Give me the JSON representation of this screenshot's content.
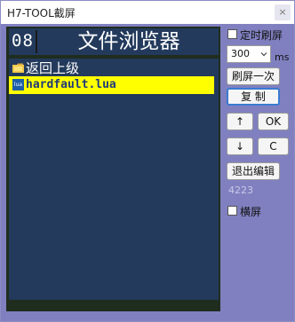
{
  "window": {
    "title": "H7-TOOL截屏",
    "close_glyph": "×"
  },
  "screen": {
    "page_number": "08",
    "title": "文件浏览器",
    "items": [
      {
        "icon": "folder-icon",
        "label": "返回上级",
        "selected": false
      },
      {
        "icon": "lua-file-icon",
        "icon_text": "lua",
        "label": "hardfault.lua",
        "selected": true
      }
    ],
    "colors": {
      "background": "#233a5c",
      "selection": "#ffff00",
      "selected_text": "#1f3a7a",
      "text": "#ffffff"
    }
  },
  "controls": {
    "timer_refresh": {
      "label": "定时刷屏",
      "checked": false
    },
    "interval": {
      "value": "300",
      "unit": "ms"
    },
    "refresh_once": "刷屏一次",
    "copy": "复 制",
    "up": "↑",
    "ok": "OK",
    "down": "↓",
    "c": "C",
    "exit_edit": "退出编辑",
    "status_value": "4223",
    "landscape": {
      "label": "横屏",
      "checked": false
    }
  },
  "colors": {
    "panel": "#8080c0",
    "lcd_border": "#1f2d1f"
  }
}
